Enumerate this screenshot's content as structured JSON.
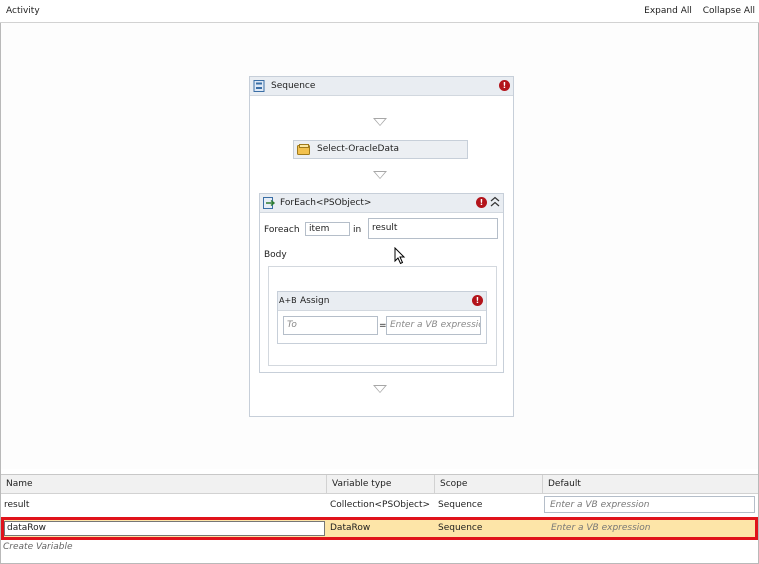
{
  "header": {
    "title": "Activity",
    "expand_all": "Expand All",
    "collapse_all": "Collapse All"
  },
  "sequence": {
    "title": "Sequence",
    "select_activity": "Select-OracleData",
    "foreach": {
      "title": "ForEach<PSObject>",
      "foreach_label": "Foreach",
      "item_value": "item",
      "in_label": "in",
      "collection_value": "result",
      "body_label": "Body",
      "assign": {
        "icon_text": "A+B",
        "title": "Assign",
        "to_placeholder": "To",
        "equals": "=",
        "value_placeholder": "Enter a VB expressic"
      }
    }
  },
  "variables": {
    "columns": [
      "Name",
      "Variable type",
      "Scope",
      "Default"
    ],
    "rows": [
      {
        "name": "result",
        "type": "Collection<PSObject>",
        "scope": "Sequence",
        "default": "Enter a VB expression"
      },
      {
        "name": "dataRow",
        "type": "DataRow",
        "scope": "Sequence",
        "default": "Enter a VB expression"
      }
    ],
    "create_link": "Create Variable"
  },
  "colors": {
    "highlight": "#e0131b",
    "selected_row": "#fde5a8",
    "error": "#b3141b"
  }
}
